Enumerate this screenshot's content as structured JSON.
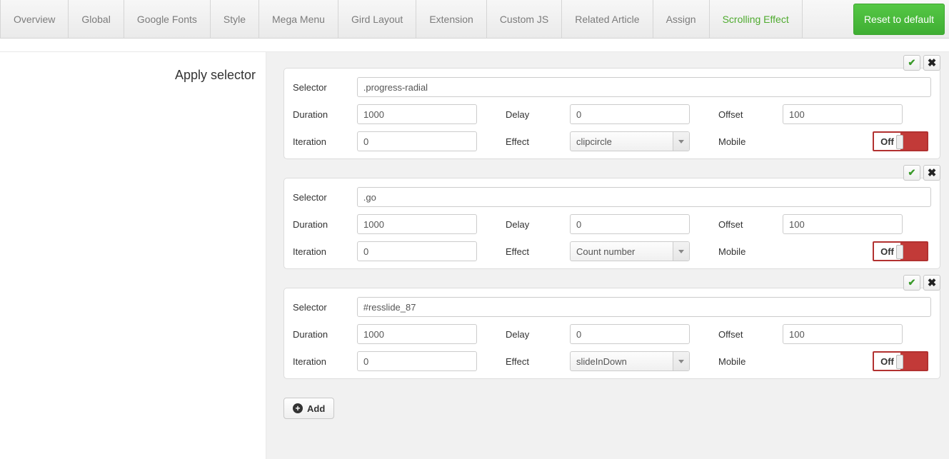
{
  "tabs": {
    "items": [
      {
        "label": "Overview"
      },
      {
        "label": "Global"
      },
      {
        "label": "Google Fonts"
      },
      {
        "label": "Style"
      },
      {
        "label": "Mega Menu"
      },
      {
        "label": "Gird Layout"
      },
      {
        "label": "Extension"
      },
      {
        "label": "Custom JS"
      },
      {
        "label": "Related Article"
      },
      {
        "label": "Assign"
      },
      {
        "label": "Scrolling Effect"
      }
    ],
    "activeIndex": 10,
    "reset_label": "Reset to default"
  },
  "section_title": "Apply selector",
  "labels": {
    "selector": "Selector",
    "duration": "Duration",
    "delay": "Delay",
    "offset": "Offset",
    "iteration": "Iteration",
    "effect": "Effect",
    "mobile": "Mobile",
    "off": "Off",
    "add": "Add"
  },
  "cards": [
    {
      "selector": ".progress-radial",
      "duration": "1000",
      "delay": "0",
      "offset": "100",
      "iteration": "0",
      "effect": "clipcircle",
      "mobile": "Off"
    },
    {
      "selector": ".go",
      "duration": "1000",
      "delay": "0",
      "offset": "100",
      "iteration": "0",
      "effect": "Count number",
      "mobile": "Off"
    },
    {
      "selector": "#resslide_87",
      "duration": "1000",
      "delay": "0",
      "offset": "100",
      "iteration": "0",
      "effect": "slideInDown",
      "mobile": "Off"
    }
  ]
}
